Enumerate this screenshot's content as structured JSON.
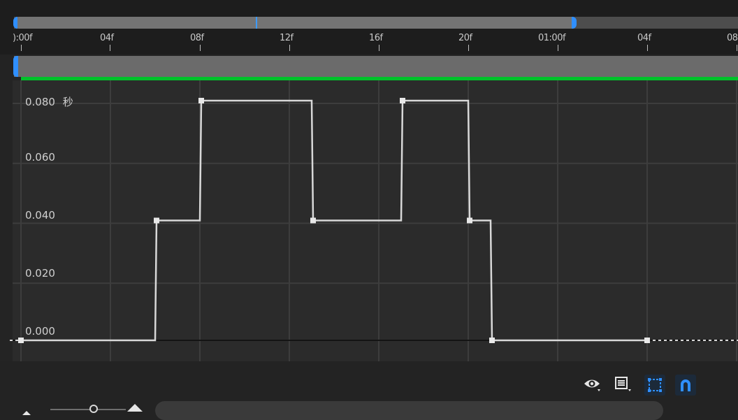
{
  "timeline": {
    "ticks": [
      "):00f",
      "04f",
      "08f",
      "12f",
      "16f",
      "20f",
      "01:00f",
      "04f",
      "08"
    ]
  },
  "graph": {
    "unit_label": "秒",
    "y_labels": [
      "0.080",
      "0.060",
      "0.040",
      "0.020",
      "0.000"
    ],
    "line_color": "#d8d8d8",
    "grid_color": "#3d3d3d"
  },
  "chart_data": {
    "type": "line",
    "interpolation": "step-like",
    "x_unit": "frames",
    "y_unit": "秒",
    "ylim": [
      0,
      0.08
    ],
    "keyframes": [
      {
        "x": 0,
        "y": 0.0
      },
      {
        "x": 6,
        "y": 0.0
      },
      {
        "x": 6,
        "y": 0.04
      },
      {
        "x": 8,
        "y": 0.04
      },
      {
        "x": 8,
        "y": 0.08
      },
      {
        "x": 13,
        "y": 0.08
      },
      {
        "x": 13,
        "y": 0.04
      },
      {
        "x": 17,
        "y": 0.04
      },
      {
        "x": 17,
        "y": 0.08
      },
      {
        "x": 20,
        "y": 0.08
      },
      {
        "x": 20,
        "y": 0.04
      },
      {
        "x": 21,
        "y": 0.04
      },
      {
        "x": 21,
        "y": 0.0
      },
      {
        "x": 28,
        "y": 0.0
      }
    ],
    "markers_at": [
      0,
      6,
      8,
      13,
      17,
      20,
      21,
      28
    ]
  },
  "toolbar": {
    "icons": [
      "eye-icon",
      "list-icon",
      "fit-selection-icon",
      "snap-magnet-icon"
    ],
    "accent_color": "#2f8fff"
  }
}
